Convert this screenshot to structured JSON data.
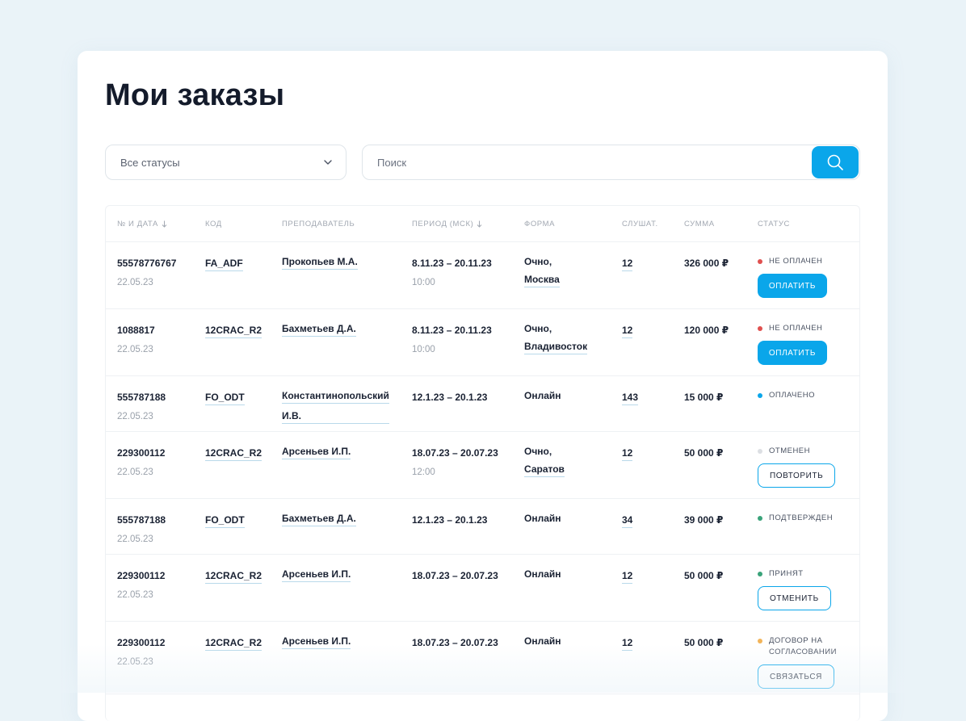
{
  "page": {
    "title": "Мои заказы"
  },
  "filters": {
    "status_value": "Все статусы",
    "search_placeholder": "Поиск"
  },
  "table": {
    "headers": [
      "№ и дата",
      "Код",
      "Преподаватель",
      "Период (МСК)",
      "Форма",
      "Слушат.",
      "Сумма",
      "Статус"
    ],
    "rows": [
      {
        "number": "55578776767",
        "date": "22.05.23",
        "code": "FA_ADF",
        "teacher_lines": [
          "Прокопьев М.А."
        ],
        "period": "8.11.23 – 20.11.23",
        "time": "10:00",
        "form": "Очно,",
        "city": "Москва",
        "listeners": "12",
        "sum": "326 000 ₽",
        "status": "не оплачен",
        "status_color": "#e0504f",
        "action": "Оплатить",
        "action_style": "primary"
      },
      {
        "number": "1088817",
        "date": "22.05.23",
        "code": "12CRAC_R2",
        "teacher_lines": [
          "Бахметьев Д.А."
        ],
        "period": "8.11.23 – 20.11.23",
        "time": "10:00",
        "form": "Очно,",
        "city": "Владивосток",
        "listeners": "12",
        "sum": "120 000 ₽",
        "status": "не оплачен",
        "status_color": "#e0504f",
        "action": "Оплатить",
        "action_style": "primary"
      },
      {
        "number": "555787188",
        "date": "22.05.23",
        "code": "FO_ODT",
        "teacher_lines": [
          "Константинопольский",
          "И.В."
        ],
        "period": "12.1.23 – 20.1.23",
        "time": "",
        "form": "Онлайн",
        "city": "",
        "listeners": "143",
        "sum": "15 000 ₽",
        "status": "оплачено",
        "status_color": "#0aa6ea",
        "action": "",
        "action_style": ""
      },
      {
        "number": "229300112",
        "date": "22.05.23",
        "code": "12CRAC_R2",
        "teacher_lines": [
          "Арсеньев И.П."
        ],
        "period": "18.07.23 – 20.07.23",
        "time": "12:00",
        "form": "Очно,",
        "city": "Саратов",
        "listeners": "12",
        "sum": "50 000 ₽",
        "status": "отменен",
        "status_color": "#dcdfe3",
        "action": "Повторить",
        "action_style": "outline"
      },
      {
        "number": "555787188",
        "date": "22.05.23",
        "code": "FO_ODT",
        "teacher_lines": [
          "Бахметьев Д.А."
        ],
        "period": "12.1.23 – 20.1.23",
        "time": "",
        "form": "Онлайн",
        "city": "",
        "listeners": "34",
        "sum": "39 000 ₽",
        "status": "подтвержден",
        "status_color": "#3aa37a",
        "action": "",
        "action_style": ""
      },
      {
        "number": "229300112",
        "date": "22.05.23",
        "code": "12CRAC_R2",
        "teacher_lines": [
          "Арсеньев И.П."
        ],
        "period": "18.07.23 – 20.07.23",
        "time": "",
        "form": "Онлайн",
        "city": "",
        "listeners": "12",
        "sum": "50 000 ₽",
        "status": "принят",
        "status_color": "#3aa37a",
        "action": "Отменить",
        "action_style": "outline"
      },
      {
        "number": "229300112",
        "date": "22.05.23",
        "code": "12CRAC_R2",
        "teacher_lines": [
          "Арсеньев И.П."
        ],
        "period": "18.07.23 – 20.07.23",
        "time": "",
        "form": "Онлайн",
        "city": "",
        "listeners": "12",
        "sum": "50 000 ₽",
        "status": "договор на согласовании",
        "status_color": "#f2b45a",
        "action": "Связаться",
        "action_style": "outline"
      }
    ]
  },
  "colors": {
    "accent": "#0aa6ea",
    "background": "#eaf3f8",
    "text": "#1a2233",
    "muted": "#9aa1ab"
  },
  "icons": {
    "dropdown": "chevron-down-icon",
    "search": "search-icon",
    "sort": "sort-arrow-icon"
  }
}
